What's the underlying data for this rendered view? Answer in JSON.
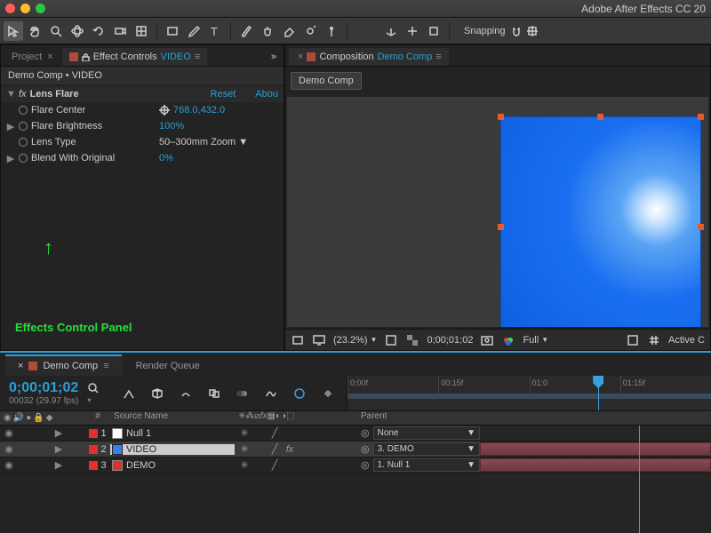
{
  "app": {
    "title": "Adobe After Effects CC 20"
  },
  "toolbar": {
    "snapping": "Snapping"
  },
  "panels": {
    "project_tab": "Project",
    "effect_controls_tab": "Effect Controls",
    "effect_controls_target": "VIDEO",
    "composition_tab": "Composition",
    "composition_target": "Demo Comp",
    "breadcrumb": "Demo Comp • VIDEO",
    "comp_subtab": "Demo Comp"
  },
  "effect": {
    "name": "Lens Flare",
    "reset": "Reset",
    "about": "Abou",
    "params": {
      "center_label": "Flare Center",
      "center_value": "768.0,432.0",
      "brightness_label": "Flare Brightness",
      "brightness_value": "100%",
      "lens_label": "Lens Type",
      "lens_value": "50–300mm Zoom",
      "blend_label": "Blend With Original",
      "blend_value": "0%"
    }
  },
  "annotation": {
    "label": "Effects Control Panel"
  },
  "viewer": {
    "zoom": "(23.2%)",
    "time": "0;00;01;02",
    "quality": "Full",
    "active": "Active C"
  },
  "timeline": {
    "tab_comp": "Demo Comp",
    "tab_render": "Render Queue",
    "timecode": "0;00;01;02",
    "framesub": "00032 (29.97 fps)",
    "cols": {
      "num": "#",
      "source": "Source Name",
      "parent": "Parent"
    },
    "ruler": [
      "0:00f",
      "00:15f",
      "01:0",
      "01:15f"
    ],
    "layers": [
      {
        "num": "1",
        "color": "#e03030",
        "box": "#ffffff",
        "name": "Null 1",
        "parent": "None",
        "fx": ""
      },
      {
        "num": "2",
        "color": "#e03030",
        "box": "#3a7ff0",
        "name": "VIDEO",
        "parent": "3. DEMO",
        "fx": "fx"
      },
      {
        "num": "3",
        "color": "#e03030",
        "box": "#e03030",
        "name": "DEMO",
        "parent": "1. Null 1",
        "fx": ""
      }
    ]
  }
}
